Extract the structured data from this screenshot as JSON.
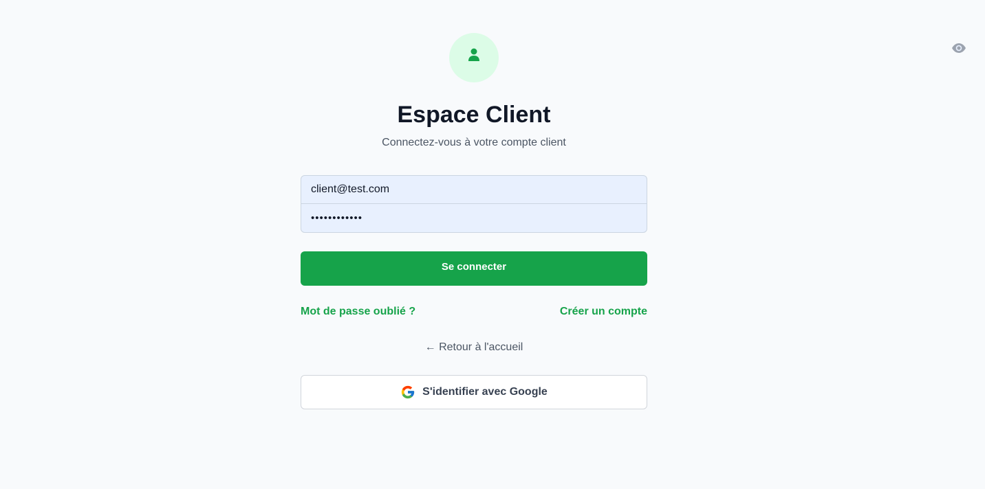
{
  "header": {
    "icon": "user-icon",
    "title": "Espace Client",
    "subtitle": "Connectez-vous à votre compte client"
  },
  "form": {
    "email_value": "client@test.com",
    "password_value": "••••••••••••",
    "toggle_icon": "eye-icon",
    "submit_label": "Se connecter"
  },
  "links": {
    "forgot_password": "Mot de passe oublié ?",
    "create_account": "Créer un compte",
    "back_home": "← Retour à l'accueil"
  },
  "google": {
    "icon": "google-logo-icon",
    "label": "S'identifier avec Google"
  },
  "colors": {
    "accent": "#16a34a",
    "accent_light": "#dcfce7",
    "background": "#f8fafc",
    "input_fill": "#e8f0fe"
  }
}
